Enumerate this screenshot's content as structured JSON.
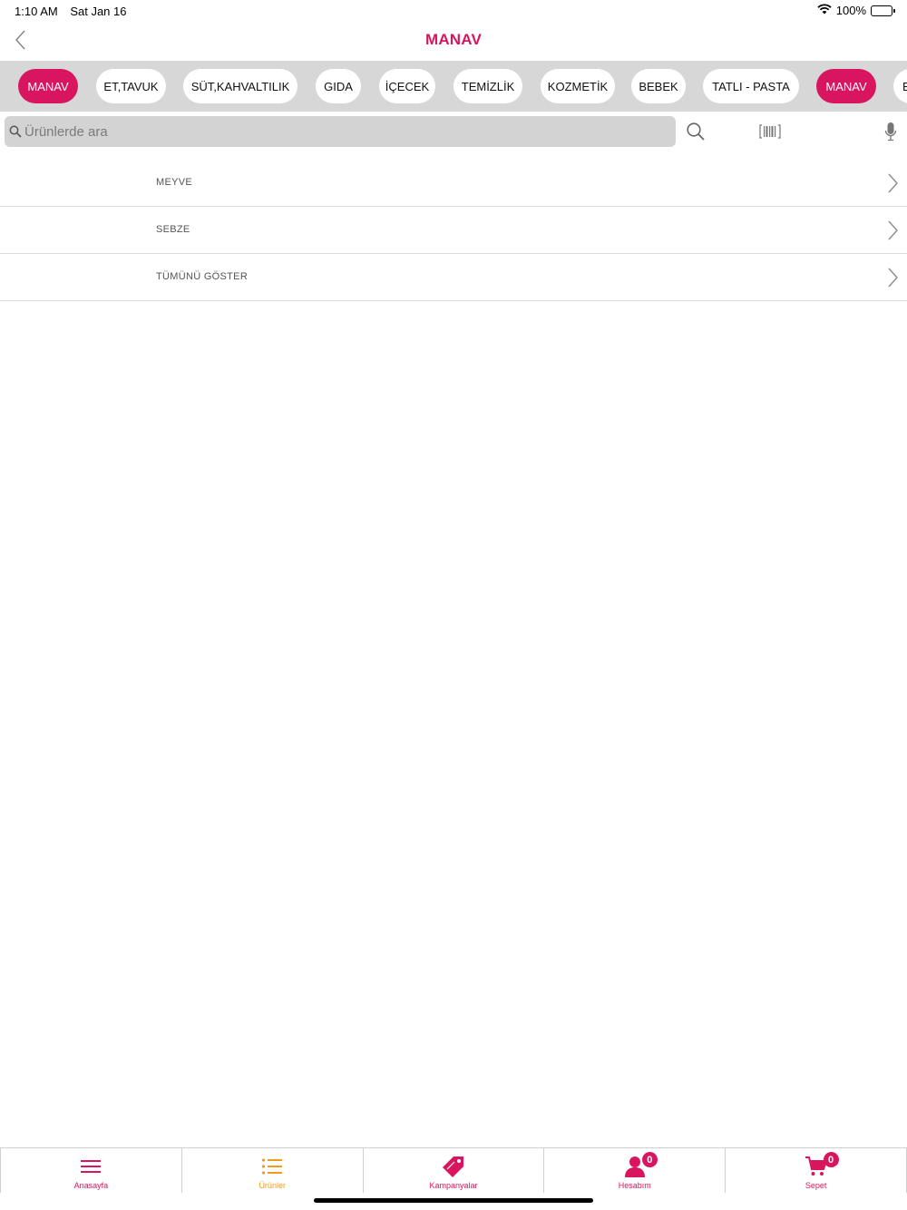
{
  "status_bar": {
    "time": "1:10 AM",
    "date": "Sat Jan 16",
    "battery": "100%"
  },
  "header": {
    "title": "MANAV"
  },
  "categories": [
    {
      "label": "MANAV",
      "active": true
    },
    {
      "label": "ET,TAVUK"
    },
    {
      "label": "SÜT,KAHVALTILIK"
    },
    {
      "label": "GIDA"
    },
    {
      "label": "İÇECEK"
    },
    {
      "label": "TEMİZLİK"
    },
    {
      "label": "KOZMETİK"
    },
    {
      "label": "BEBEK"
    },
    {
      "label": "TATLI - PASTA"
    },
    {
      "label": "MANAV",
      "active": true
    },
    {
      "label": "B"
    }
  ],
  "search": {
    "placeholder": "Ürünlerde ara",
    "value": ""
  },
  "list_items": [
    "MEYVE",
    "SEBZE",
    "TÜMÜNÜ GÖSTER"
  ],
  "tabs": [
    {
      "label": "Anasayfa",
      "icon": "menu-icon"
    },
    {
      "label": "Ürünler",
      "icon": "list-icon",
      "active": true
    },
    {
      "label": "Kampanyalar",
      "icon": "tag-icon"
    },
    {
      "label": "Hesabım",
      "icon": "user-icon",
      "badge": "0"
    },
    {
      "label": "Sepet",
      "icon": "cart-icon",
      "badge": "0"
    }
  ],
  "colors": {
    "accent": "#d9155f",
    "active_tab": "#f29a1a",
    "strip_bg": "#d7d7d7"
  }
}
